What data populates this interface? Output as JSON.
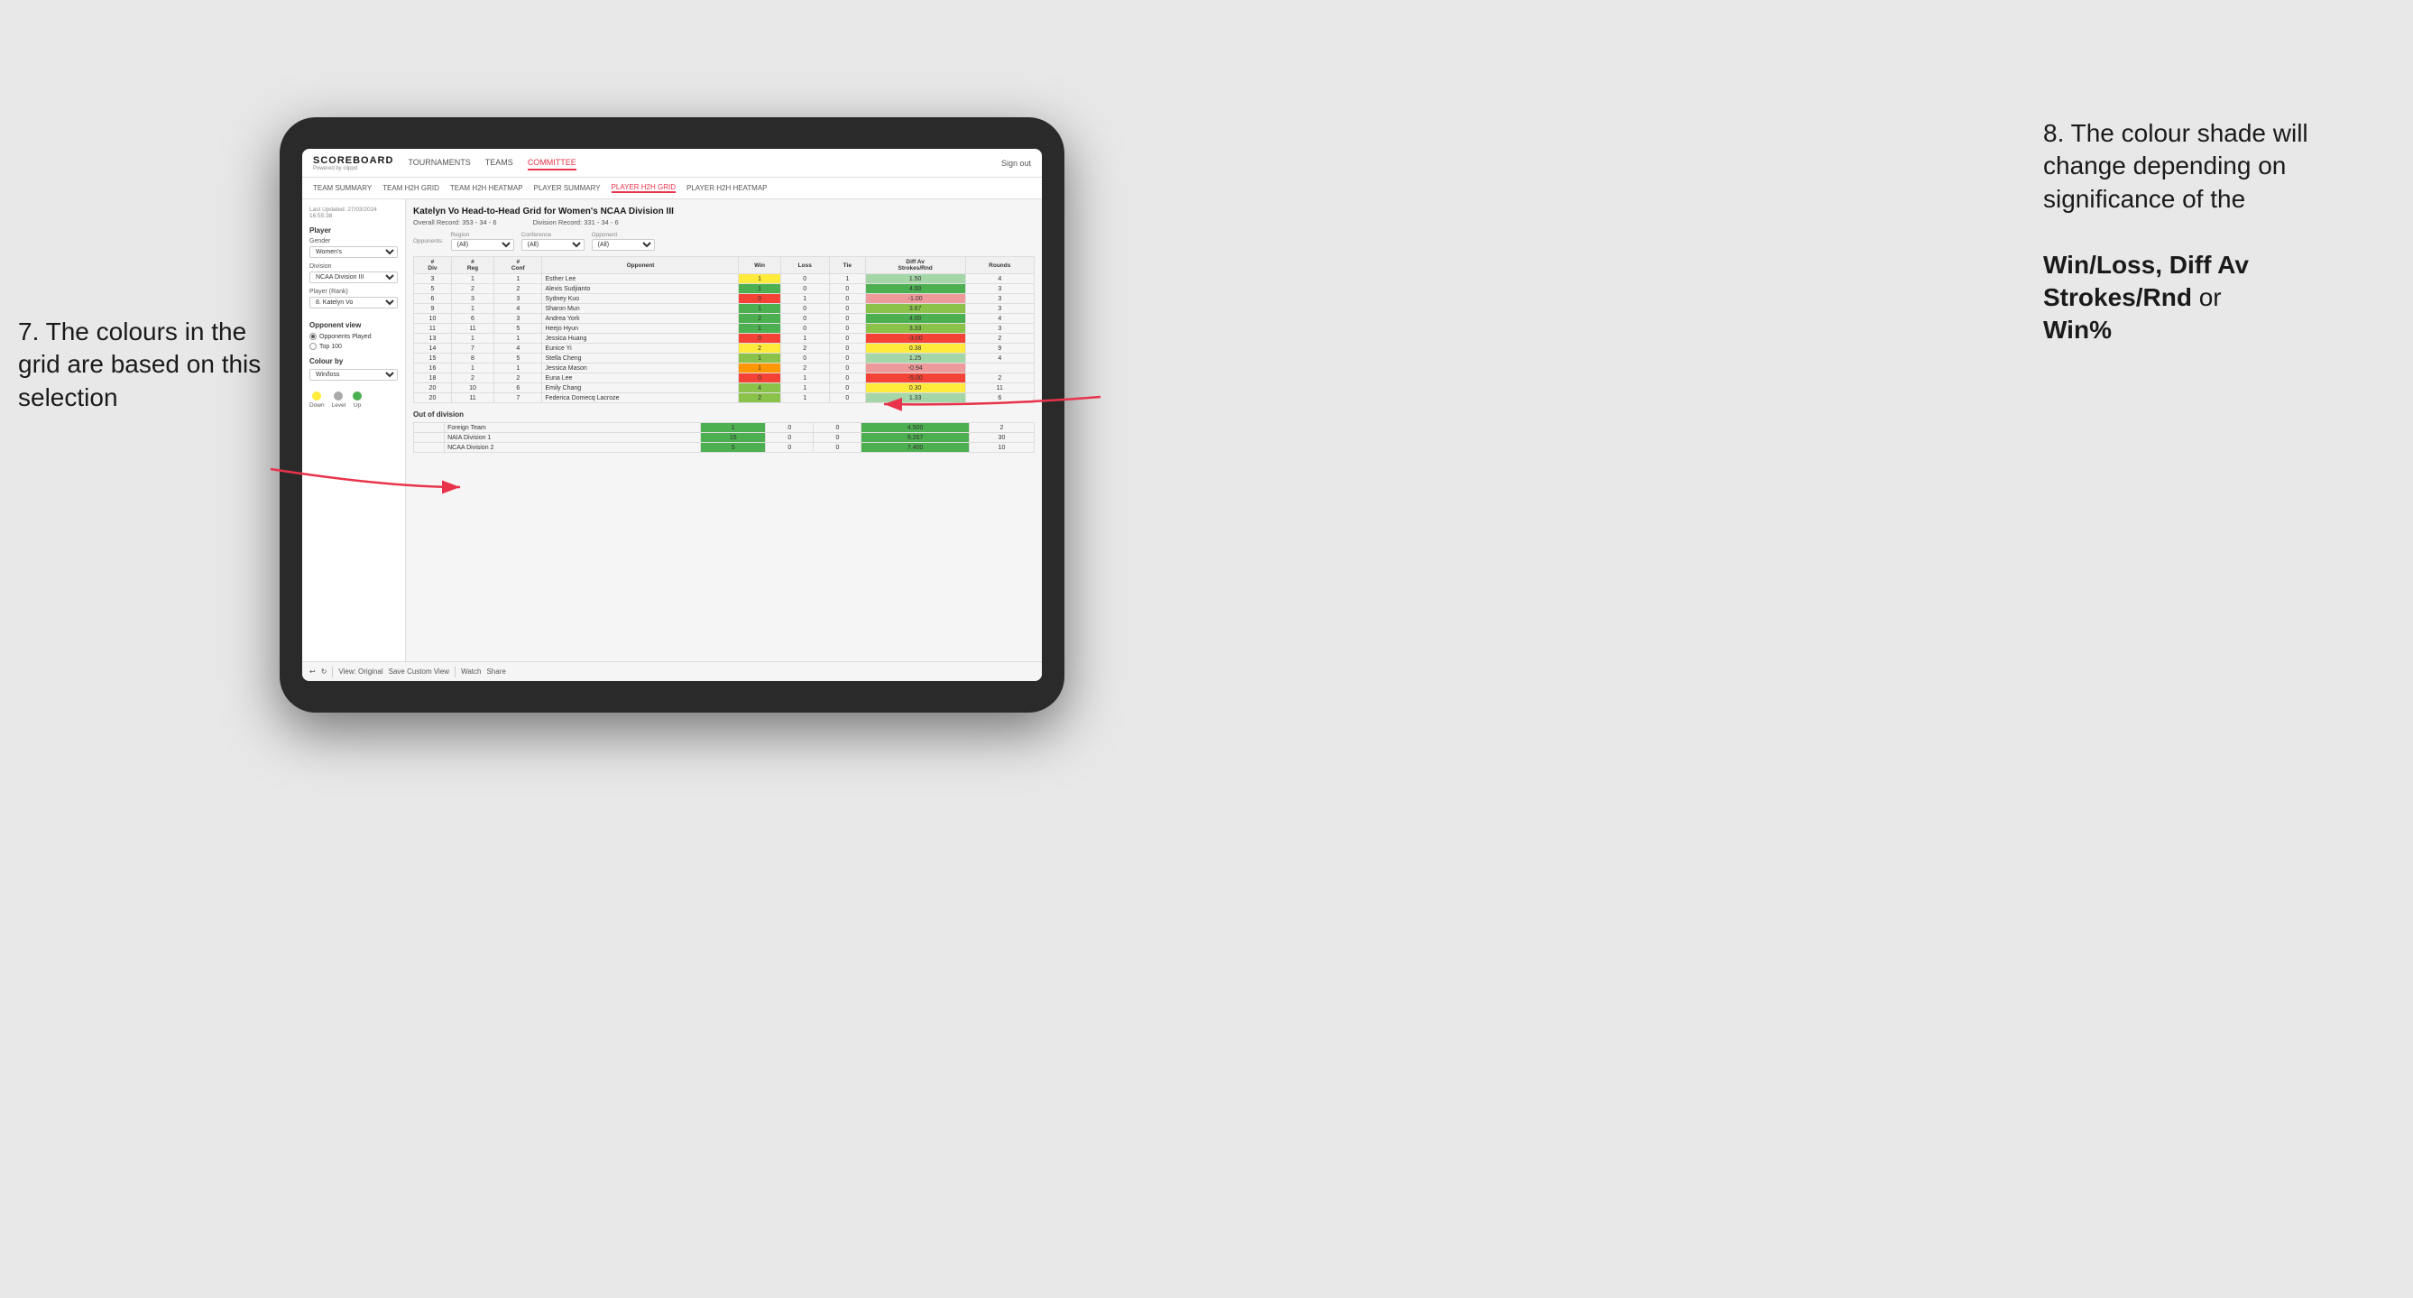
{
  "annotations": {
    "left_title": "7. The colours in the grid are based on this selection",
    "right_title": "8. The colour shade will change depending on significance of the",
    "right_bold1": "Win/Loss, Diff Av Strokes/Rnd",
    "right_bold2": "or",
    "right_bold3": "Win%"
  },
  "nav": {
    "logo": "SCOREBOARD",
    "logo_sub": "Powered by clippd",
    "links": [
      "TOURNAMENTS",
      "TEAMS",
      "COMMITTEE"
    ],
    "active_link": "COMMITTEE",
    "right": "Sign out"
  },
  "subnav": {
    "links": [
      "TEAM SUMMARY",
      "TEAM H2H GRID",
      "TEAM H2H HEATMAP",
      "PLAYER SUMMARY",
      "PLAYER H2H GRID",
      "PLAYER H2H HEATMAP"
    ],
    "active": "PLAYER H2H GRID"
  },
  "sidebar": {
    "last_updated_label": "Last Updated: 27/03/2024",
    "last_updated_time": "16:55:38",
    "player_section": "Player",
    "gender_label": "Gender",
    "gender_value": "Women's",
    "division_label": "Division",
    "division_value": "NCAA Division III",
    "player_rank_label": "Player (Rank)",
    "player_rank_value": "8. Katelyn Vo",
    "opponent_view": "Opponent view",
    "opponents_played": "Opponents Played",
    "top_100": "Top 100",
    "colour_by": "Colour by",
    "colour_value": "Win/loss",
    "legend_down": "Down",
    "legend_level": "Level",
    "legend_up": "Up"
  },
  "grid": {
    "title": "Katelyn Vo Head-to-Head Grid for Women's NCAA Division III",
    "overall_record_label": "Overall Record:",
    "overall_record": "353 - 34 - 6",
    "division_record_label": "Division Record:",
    "division_record": "331 - 34 - 6",
    "region_label": "Region",
    "conference_label": "Conference",
    "opponent_label": "Opponent",
    "opponents_label": "Opponents:",
    "all_option": "(All)",
    "headers": {
      "div": "#\nDiv",
      "reg": "#\nReg",
      "conf": "#\nConf",
      "opponent": "Opponent",
      "win": "Win",
      "loss": "Loss",
      "tie": "Tie",
      "diff_av": "Diff Av\nStrokes/Rnd",
      "rounds": "Rounds"
    },
    "rows": [
      {
        "div": "3",
        "reg": "1",
        "conf": "1",
        "opponent": "Esther Lee",
        "win": 1,
        "loss": 0,
        "tie": 1,
        "diff_av": 1.5,
        "rounds": 4,
        "win_color": "yellow",
        "diff_color": "green"
      },
      {
        "div": "5",
        "reg": "2",
        "conf": "2",
        "opponent": "Alexis Sudjianto",
        "win": 1,
        "loss": 0,
        "tie": 0,
        "diff_av": 4.0,
        "rounds": 3,
        "win_color": "green-dark",
        "diff_color": "green-dark"
      },
      {
        "div": "6",
        "reg": "3",
        "conf": "3",
        "opponent": "Sydney Kuo",
        "win": 0,
        "loss": 1,
        "tie": 0,
        "diff_av": -1.0,
        "rounds": 3,
        "win_color": "red",
        "diff_color": "red-light"
      },
      {
        "div": "9",
        "reg": "1",
        "conf": "4",
        "opponent": "Sharon Mun",
        "win": 1,
        "loss": 0,
        "tie": 0,
        "diff_av": 3.67,
        "rounds": 3,
        "win_color": "green-dark",
        "diff_color": "green-mid"
      },
      {
        "div": "10",
        "reg": "6",
        "conf": "3",
        "opponent": "Andrea York",
        "win": 2,
        "loss": 0,
        "tie": 0,
        "diff_av": 4.0,
        "rounds": 4,
        "win_color": "green-dark",
        "diff_color": "green-dark"
      },
      {
        "div": "11",
        "reg": "11",
        "conf": "5",
        "opponent": "Heejo Hyun",
        "win": 1,
        "loss": 0,
        "tie": 0,
        "diff_av": 3.33,
        "rounds": 3,
        "win_color": "green-dark",
        "diff_color": "green-mid"
      },
      {
        "div": "13",
        "reg": "1",
        "conf": "1",
        "opponent": "Jessica Huang",
        "win": 0,
        "loss": 1,
        "tie": 0,
        "diff_av": -3.0,
        "rounds": 2,
        "win_color": "red",
        "diff_color": "red"
      },
      {
        "div": "14",
        "reg": "7",
        "conf": "4",
        "opponent": "Eunice Yi",
        "win": 2,
        "loss": 2,
        "tie": 0,
        "diff_av": 0.38,
        "rounds": 9,
        "win_color": "yellow",
        "diff_color": "yellow"
      },
      {
        "div": "15",
        "reg": "8",
        "conf": "5",
        "opponent": "Stella Cheng",
        "win": 1,
        "loss": 0,
        "tie": 0,
        "diff_av": 1.25,
        "rounds": 4,
        "win_color": "green-mid",
        "diff_color": "green"
      },
      {
        "div": "16",
        "reg": "1",
        "conf": "1",
        "opponent": "Jessica Mason",
        "win": 1,
        "loss": 2,
        "tie": 0,
        "diff_av": -0.94,
        "rounds": "",
        "win_color": "orange",
        "diff_color": "red-light"
      },
      {
        "div": "18",
        "reg": "2",
        "conf": "2",
        "opponent": "Euna Lee",
        "win": 0,
        "loss": 1,
        "tie": 0,
        "diff_av": -5.0,
        "rounds": 2,
        "win_color": "red",
        "diff_color": "red"
      },
      {
        "div": "20",
        "reg": "10",
        "conf": "6",
        "opponent": "Emily Chang",
        "win": 4,
        "loss": 1,
        "tie": 0,
        "diff_av": 0.3,
        "rounds": 11,
        "win_color": "green-mid",
        "diff_color": "yellow"
      },
      {
        "div": "20",
        "reg": "11",
        "conf": "7",
        "opponent": "Federica Domecq Lacroze",
        "win": 2,
        "loss": 1,
        "tie": 0,
        "diff_av": 1.33,
        "rounds": 6,
        "win_color": "green-mid",
        "diff_color": "green"
      }
    ],
    "out_of_division": "Out of division",
    "ood_rows": [
      {
        "label": "Foreign Team",
        "win": 1,
        "loss": 0,
        "tie": 0,
        "diff_av": 4.5,
        "rounds": 2,
        "win_color": "green-dark",
        "diff_color": "green-dark"
      },
      {
        "label": "NAIA Division 1",
        "win": 15,
        "loss": 0,
        "tie": 0,
        "diff_av": 9.267,
        "rounds": 30,
        "win_color": "green-dark",
        "diff_color": "green-dark"
      },
      {
        "label": "NCAA Division 2",
        "win": 5,
        "loss": 0,
        "tie": 0,
        "diff_av": 7.4,
        "rounds": 10,
        "win_color": "green-dark",
        "diff_color": "green-dark"
      }
    ]
  },
  "toolbar": {
    "view_original": "View: Original",
    "save_custom": "Save Custom View",
    "watch": "Watch",
    "share": "Share"
  }
}
